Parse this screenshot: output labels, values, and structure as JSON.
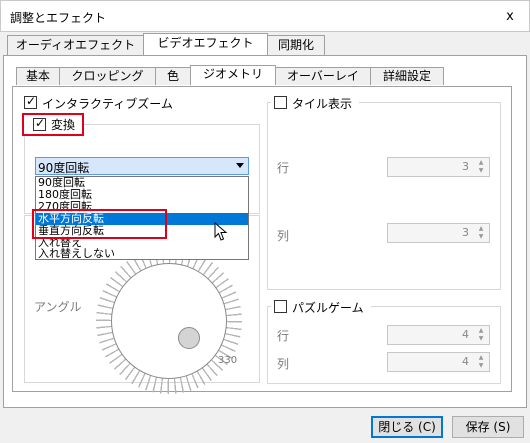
{
  "window": {
    "title": "調整とエフェクト",
    "close_glyph": "x"
  },
  "main_tabs": [
    "オーディオエフェクト",
    "ビデオエフェクト",
    "同期化"
  ],
  "sub_tabs": [
    "基本",
    "クロッピング",
    "色",
    "ジオメトリ",
    "オーバーレイ",
    "詳細設定"
  ],
  "geometry": {
    "interactive_zoom": {
      "label": "インタラクティブズーム",
      "checked": true
    },
    "transform": {
      "label": "変換",
      "checked": true,
      "selected": "90度回転",
      "options": [
        "90度回転",
        "180度回転",
        "270度回転",
        "水平方向反転",
        "垂直方向反転",
        "入れ替え",
        "入れ替えしない"
      ],
      "highlighted_option": "水平方向反転"
    },
    "angle_label": "アングル",
    "angle_value": "330",
    "tile": {
      "label": "タイル表示",
      "checked": false,
      "row_label": "行",
      "row_value": "3",
      "col_label": "列",
      "col_value": "3"
    },
    "puzzle": {
      "label": "パズルゲーム",
      "checked": false,
      "row_label": "行",
      "row_value": "4",
      "col_label": "列",
      "col_value": "4"
    }
  },
  "buttons": {
    "close": "閉じる (C)",
    "save": "保存 (S)"
  },
  "colors": {
    "highlight_red": "#e0001a",
    "selection_blue": "#0078d7"
  }
}
